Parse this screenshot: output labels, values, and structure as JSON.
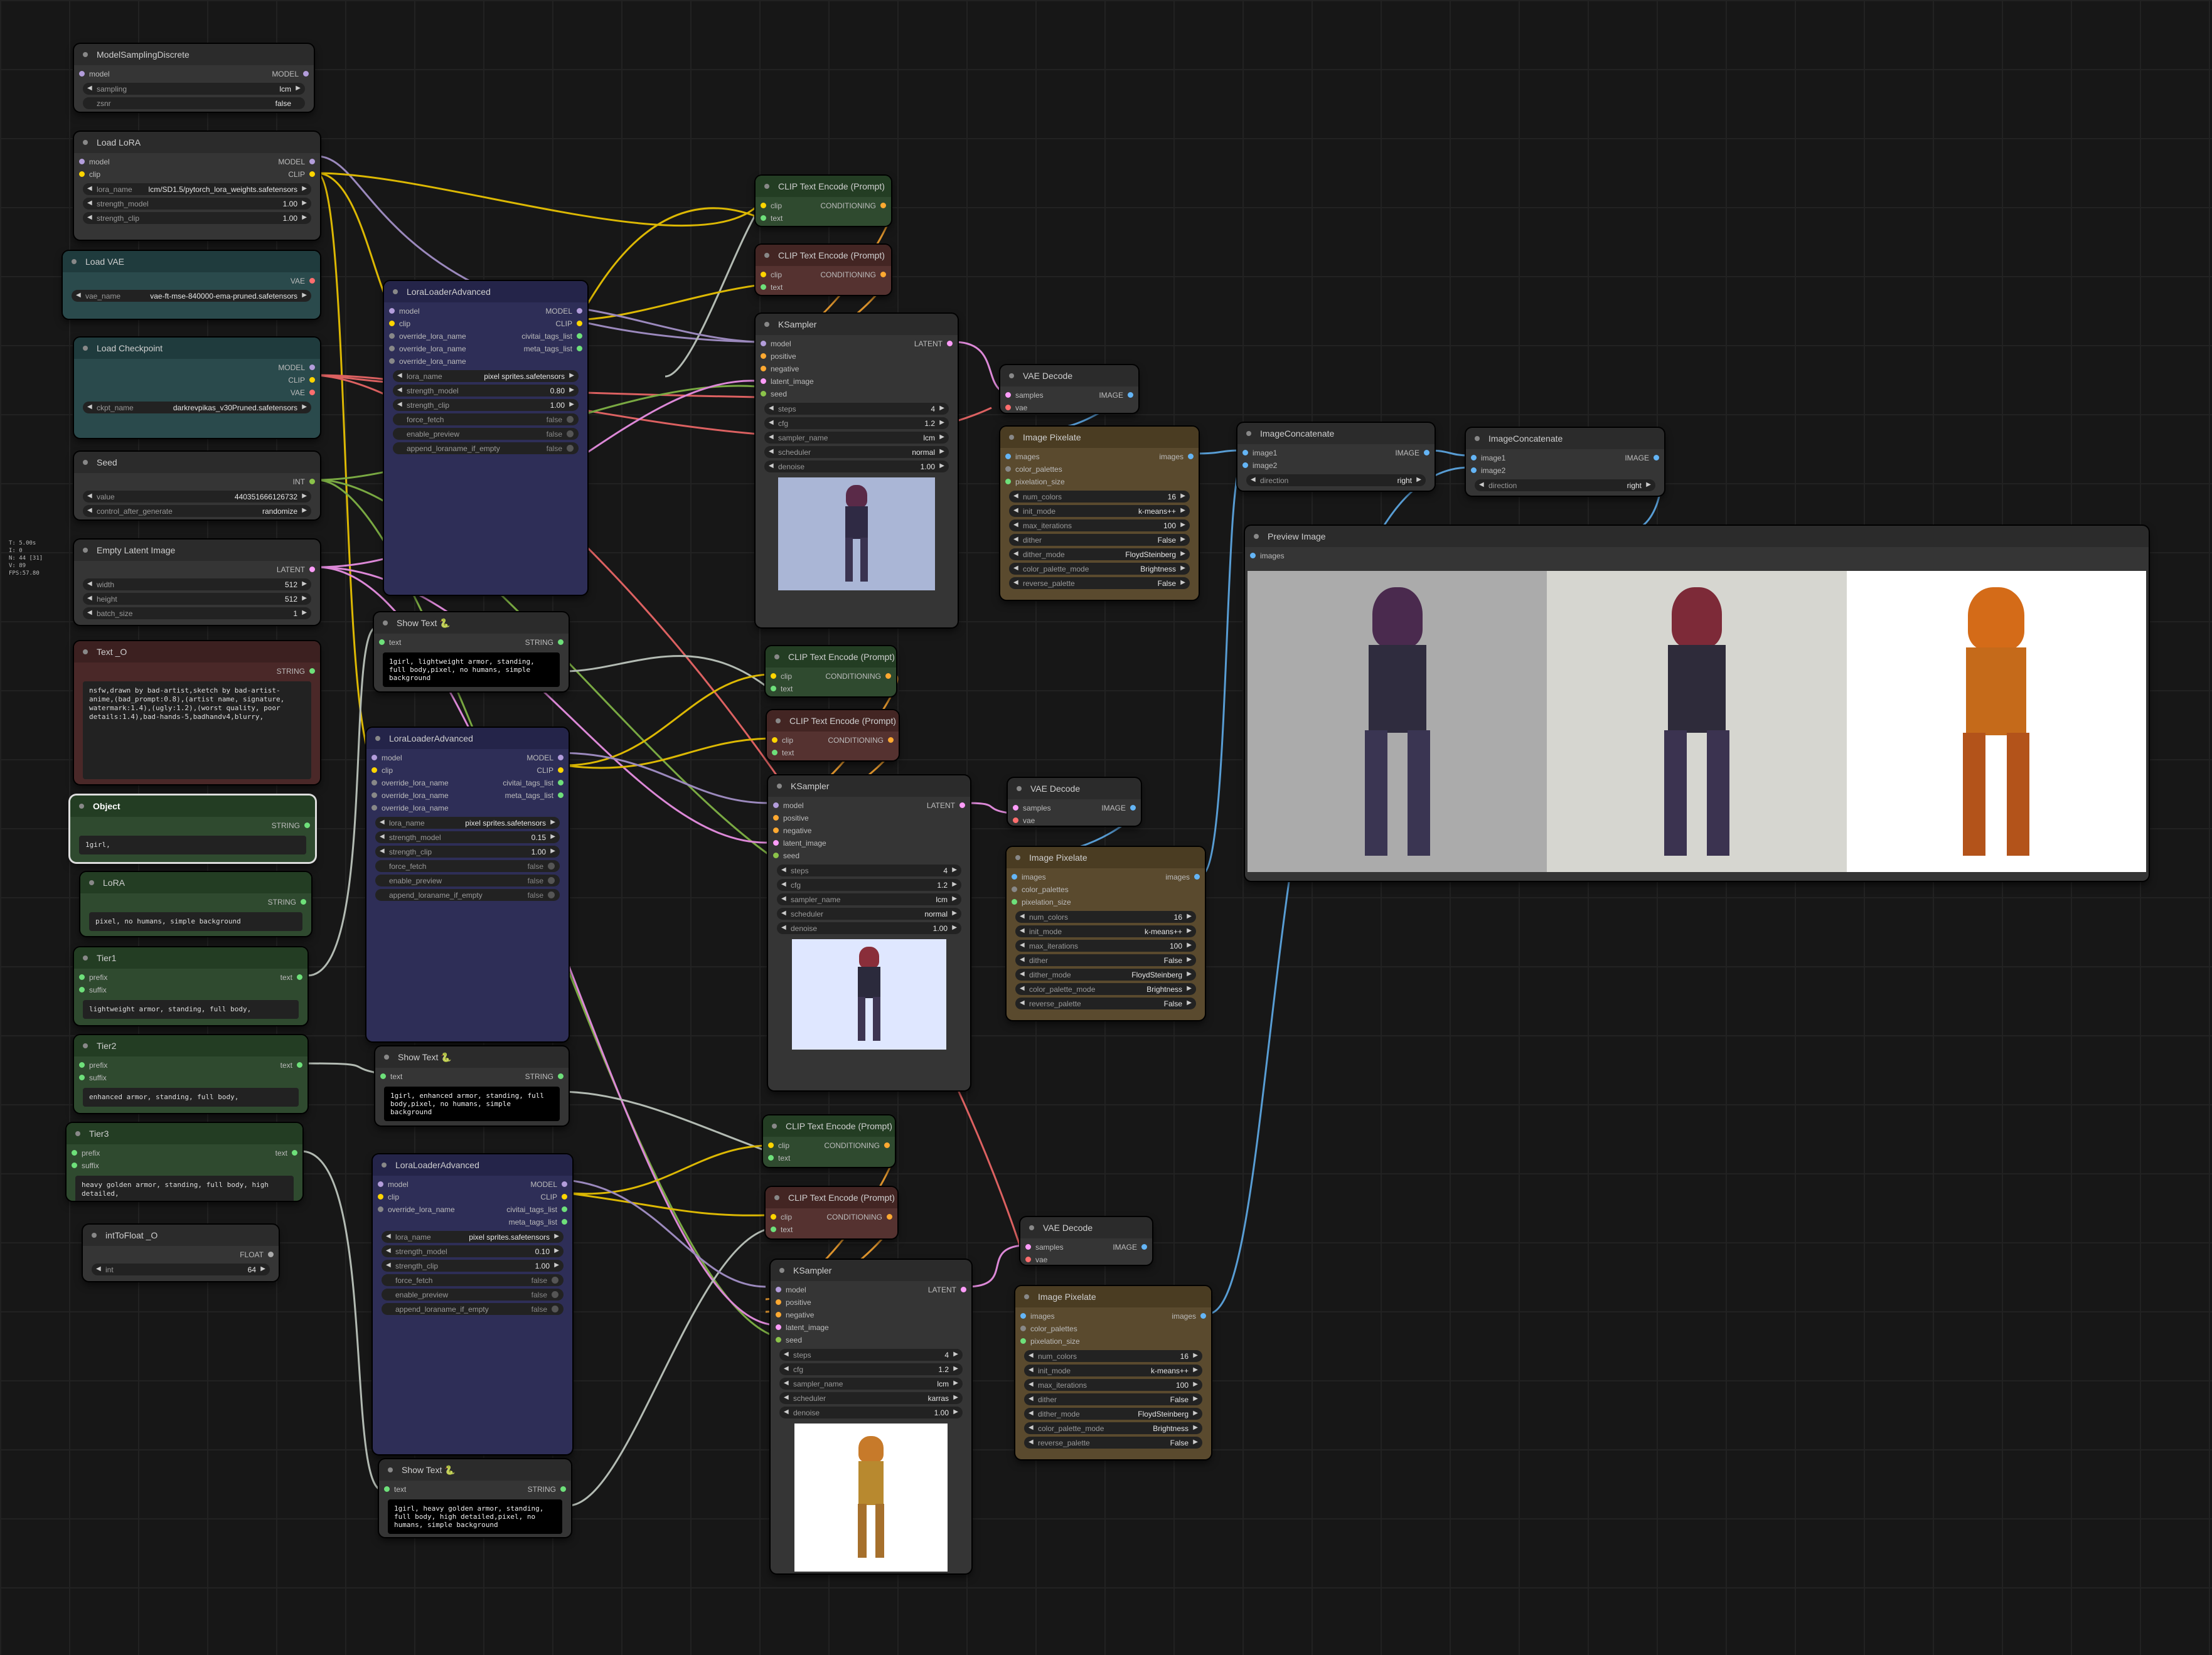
{
  "stats": [
    "T: 5.00s",
    "I: 0",
    "N: 44 [31]",
    "V: 89",
    "FPS:57.80"
  ],
  "colors": {
    "model": "#b39ddb",
    "clip": "#ffd500",
    "vae": "#ff6e6e",
    "latent": "#ff9cf9",
    "int": "#8bc34a",
    "cond": "#ffa931",
    "image": "#64b5f6",
    "string": "#6ee07a",
    "float": "#aaaaaa"
  },
  "msd": {
    "title": "ModelSamplingDiscrete",
    "in_model": "model",
    "out": "MODEL",
    "w": [
      {
        "l": "sampling",
        "v": "lcm"
      },
      {
        "l": "zsnr",
        "v": "false"
      }
    ]
  },
  "loadlora": {
    "title": "Load LoRA",
    "in": [
      "model",
      "clip"
    ],
    "out": [
      "MODEL",
      "CLIP"
    ],
    "w": [
      {
        "l": "lora_name",
        "v": "lcm/SD1.5/pytorch_lora_weights.safetensors"
      },
      {
        "l": "strength_model",
        "v": "1.00"
      },
      {
        "l": "strength_clip",
        "v": "1.00"
      }
    ]
  },
  "loadvae": {
    "title": "Load VAE",
    "out": "VAE",
    "w": [
      {
        "l": "vae_name",
        "v": "vae-ft-mse-840000-ema-pruned.safetensors"
      }
    ]
  },
  "ckpt": {
    "title": "Load Checkpoint",
    "out": [
      "MODEL",
      "CLIP",
      "VAE"
    ],
    "w": [
      {
        "l": "ckpt_name",
        "v": "darkrevpikas_v30Pruned.safetensors"
      }
    ]
  },
  "seed": {
    "title": "Seed",
    "out": "INT",
    "w": [
      {
        "l": "value",
        "v": "440351666126732"
      },
      {
        "l": "control_after_generate",
        "v": "randomize"
      }
    ]
  },
  "latent": {
    "title": "Empty Latent Image",
    "out": "LATENT",
    "w": [
      {
        "l": "width",
        "v": "512"
      },
      {
        "l": "height",
        "v": "512"
      },
      {
        "l": "batch_size",
        "v": "1"
      }
    ]
  },
  "texto": {
    "title": "Text _O",
    "out": "STRING",
    "text": "nsfw,drawn by bad-artist,sketch by bad-artist-anime,(bad_prompt:0.8),(artist name, signature, watermark:1.4),(ugly:1.2),(worst quality, poor details:1.4),bad-hands-5,badhandv4,blurry,"
  },
  "object": {
    "title": "Object",
    "out": "STRING",
    "text": "1girl,"
  },
  "lora": {
    "title": "LoRA",
    "out": "STRING",
    "text": "pixel, no humans, simple background"
  },
  "tier1": {
    "title": "Tier1",
    "in": [
      "prefix",
      "suffix"
    ],
    "out": "text",
    "text": "lightweight armor, standing, full body,"
  },
  "tier2": {
    "title": "Tier2",
    "in": [
      "prefix",
      "suffix"
    ],
    "out": "text",
    "text": "enhanced armor, standing, full body,"
  },
  "tier3": {
    "title": "Tier3",
    "in": [
      "prefix",
      "suffix"
    ],
    "out": "text",
    "text": "heavy golden armor, standing, full body, high detailed,"
  },
  "inttofloat": {
    "title": "intToFloat _O",
    "out": "FLOAT",
    "w": [
      {
        "l": "int",
        "v": "64"
      }
    ]
  },
  "lla1": {
    "title": "LoraLoaderAdvanced",
    "in": [
      "model",
      "clip",
      "override_lora_name",
      "override_lora_name",
      "override_lora_name"
    ],
    "out": [
      "MODEL",
      "CLIP",
      "civitai_tags_list",
      "meta_tags_list"
    ],
    "w": [
      {
        "l": "lora_name",
        "v": "pixel sprites.safetensors"
      },
      {
        "l": "strength_model",
        "v": "0.80"
      },
      {
        "l": "strength_clip",
        "v": "1.00"
      },
      {
        "l": "force_fetch",
        "v": "false"
      },
      {
        "l": "enable_preview",
        "v": "false"
      },
      {
        "l": "append_loraname_if_empty",
        "v": "false"
      }
    ]
  },
  "lla2": {
    "title": "LoraLoaderAdvanced",
    "in": [
      "model",
      "clip",
      "override_lora_name",
      "override_lora_name",
      "override_lora_name"
    ],
    "out": [
      "MODEL",
      "CLIP",
      "civitai_tags_list",
      "meta_tags_list"
    ],
    "w": [
      {
        "l": "lora_name",
        "v": "pixel sprites.safetensors"
      },
      {
        "l": "strength_model",
        "v": "0.15"
      },
      {
        "l": "strength_clip",
        "v": "1.00"
      },
      {
        "l": "force_fetch",
        "v": "false"
      },
      {
        "l": "enable_preview",
        "v": "false"
      },
      {
        "l": "append_loraname_if_empty",
        "v": "false"
      }
    ]
  },
  "lla3": {
    "title": "LoraLoaderAdvanced",
    "in": [
      "model",
      "clip",
      "override_lora_name"
    ],
    "out": [
      "MODEL",
      "CLIP",
      "civitai_tags_list",
      "meta_tags_list"
    ],
    "w": [
      {
        "l": "lora_name",
        "v": "pixel sprites.safetensors"
      },
      {
        "l": "strength_model",
        "v": "0.10"
      },
      {
        "l": "strength_clip",
        "v": "1.00"
      },
      {
        "l": "force_fetch",
        "v": "false"
      },
      {
        "l": "enable_preview",
        "v": "false"
      },
      {
        "l": "append_loraname_if_empty",
        "v": "false"
      }
    ]
  },
  "show1": {
    "title": "Show Text 🐍",
    "in": "text",
    "out": "STRING",
    "text": "1girl, lightweight armor, standing, full body,pixel, no humans, simple background"
  },
  "show2": {
    "title": "Show Text 🐍",
    "in": "text",
    "out": "STRING",
    "text": "1girl, enhanced armor, standing, full body,pixel, no humans, simple background"
  },
  "show3": {
    "title": "Show Text 🐍",
    "in": "text",
    "out": "STRING",
    "text": "1girl, heavy golden armor, standing, full body, high detailed,pixel, no humans, simple background"
  },
  "clip": {
    "title": "CLIP Text Encode (Prompt)",
    "in": [
      "clip",
      "text"
    ],
    "out": "CONDITIONING"
  },
  "ks": {
    "title": "KSampler",
    "in": [
      "model",
      "positive",
      "negative",
      "latent_image",
      "seed"
    ],
    "out": "LATENT"
  },
  "ks1": {
    "w": [
      {
        "l": "steps",
        "v": "4"
      },
      {
        "l": "cfg",
        "v": "1.2"
      },
      {
        "l": "sampler_name",
        "v": "lcm"
      },
      {
        "l": "scheduler",
        "v": "normal"
      },
      {
        "l": "denoise",
        "v": "1.00"
      }
    ]
  },
  "ks2": {
    "w": [
      {
        "l": "steps",
        "v": "4"
      },
      {
        "l": "cfg",
        "v": "1.2"
      },
      {
        "l": "sampler_name",
        "v": "lcm"
      },
      {
        "l": "scheduler",
        "v": "normal"
      },
      {
        "l": "denoise",
        "v": "1.00"
      }
    ]
  },
  "ks3": {
    "w": [
      {
        "l": "steps",
        "v": "4"
      },
      {
        "l": "cfg",
        "v": "1.2"
      },
      {
        "l": "sampler_name",
        "v": "lcm"
      },
      {
        "l": "scheduler",
        "v": "karras"
      },
      {
        "l": "denoise",
        "v": "1.00"
      }
    ]
  },
  "vaed": {
    "title": "VAE Decode",
    "in": [
      "samples",
      "vae"
    ],
    "out": "IMAGE"
  },
  "pix": {
    "title": "Image Pixelate",
    "in": [
      "images",
      "color_palettes",
      "pixelation_size"
    ],
    "out": "images",
    "w": [
      {
        "l": "num_colors",
        "v": "16"
      },
      {
        "l": "init_mode",
        "v": "k-means++"
      },
      {
        "l": "max_iterations",
        "v": "100"
      },
      {
        "l": "dither",
        "v": "False"
      },
      {
        "l": "dither_mode",
        "v": "FloydSteinberg"
      },
      {
        "l": "color_palette_mode",
        "v": "Brightness"
      },
      {
        "l": "reverse_palette",
        "v": "False"
      }
    ]
  },
  "concat": {
    "title": "ImageConcatenate",
    "in": [
      "image1",
      "image2"
    ],
    "out": "IMAGE",
    "w": [
      {
        "l": "direction",
        "v": "right"
      }
    ]
  },
  "preview": {
    "title": "Preview Image",
    "in": "images"
  }
}
